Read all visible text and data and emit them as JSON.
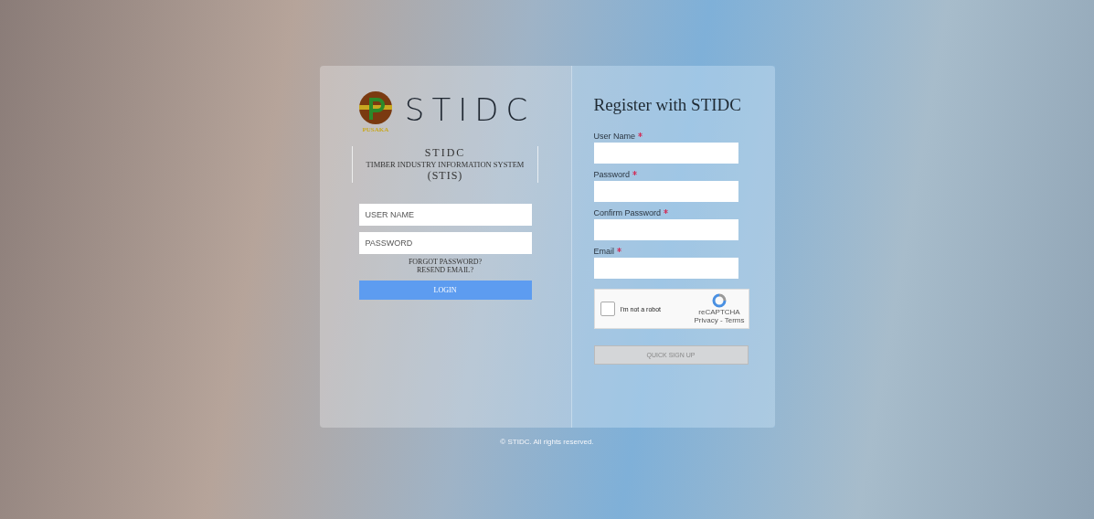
{
  "login": {
    "logo_text": "STIDC",
    "logo_caption": "PUSAKA",
    "org": "STIDC",
    "system": "TIMBER INDUSTRY INFORMATION SYSTEM",
    "acronym": "(STIS)",
    "fields": [
      {
        "placeholder": "USER NAME"
      },
      {
        "placeholder": "PASSWORD"
      }
    ],
    "links": [
      "FORGOT PASSWORD?",
      "RESEND EMAIL?"
    ],
    "button": "LOGIN"
  },
  "register": {
    "title": "Register with STIDC",
    "fields": [
      {
        "label": "User Name",
        "required": true
      },
      {
        "label": "Password",
        "required": true
      },
      {
        "label": "Confirm Password",
        "required": true
      },
      {
        "label": "Email",
        "required": true
      }
    ],
    "captcha": {
      "label": "I'm not a robot",
      "checked": false,
      "brand": "reCAPTCHA",
      "links": "Privacy - Terms"
    },
    "button": {
      "label": "QUICK SIGN UP",
      "disabled": true
    }
  },
  "footer": "© STIDC. All rights reserved."
}
